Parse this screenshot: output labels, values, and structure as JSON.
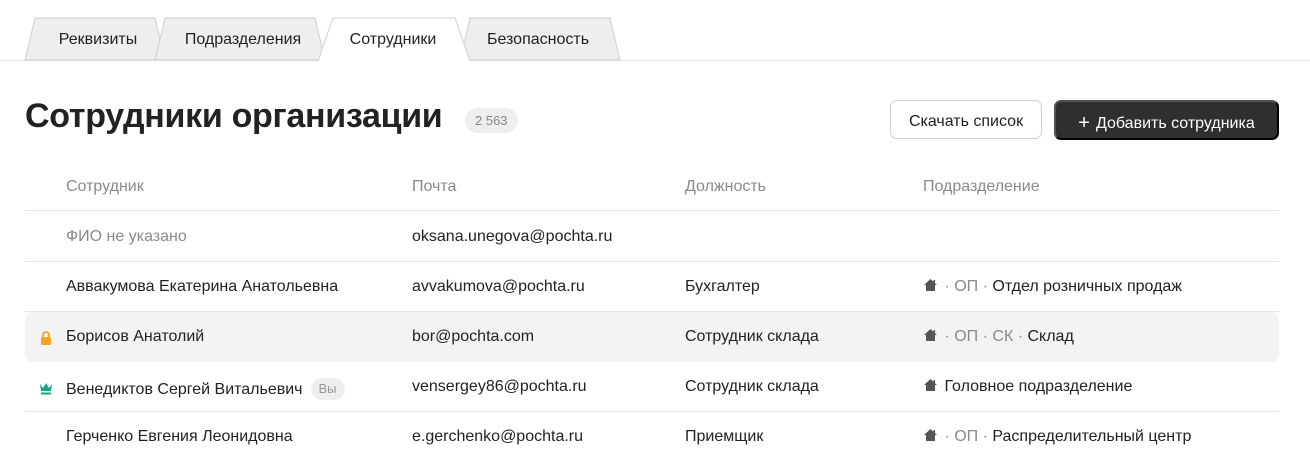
{
  "tabs": [
    {
      "label": "Реквизиты",
      "active": false
    },
    {
      "label": "Подразделения",
      "active": false
    },
    {
      "label": "Сотрудники",
      "active": true
    },
    {
      "label": "Безопасность",
      "active": false
    }
  ],
  "header": {
    "title": "Сотрудники организации",
    "count": "2 563",
    "download_label": "Скачать список",
    "add_label": "Добавить сотрудника",
    "add_icon": "+"
  },
  "table": {
    "columns": [
      "Сотрудник",
      "Почта",
      "Должность",
      "Подразделение"
    ],
    "rows": [
      {
        "name": "ФИО не указано",
        "email": "oksana.unegova@pochta.ru",
        "role": "",
        "dept_path": "",
        "dept": "",
        "icon": "none",
        "you": ""
      },
      {
        "name": "Аввакумова Екатерина Анатольевна",
        "email": "avvakumova@pochta.ru",
        "role": "Бухгалтер",
        "dept_path": " · ОП · ",
        "dept": "Отдел розничных продаж",
        "icon": "none",
        "you": ""
      },
      {
        "name": "Борисов Анатолий",
        "email": "bor@pochta.com",
        "role": "Сотрудник склада",
        "dept_path": " · ОП · СК · ",
        "dept": "Склад",
        "icon": "lock-icon",
        "you": ""
      },
      {
        "name": "Венедиктов Сергей Витальевич",
        "email": "vensergey86@pochta.ru",
        "role": "Сотрудник склада",
        "dept_path": " ",
        "dept": "Головное подразделение",
        "icon": "crown-icon",
        "you": "Вы"
      },
      {
        "name": "Герченко Евгения Леонидовна",
        "email": "e.gerchenko@pochta.ru",
        "role": "Приемщик",
        "dept_path": " · ОП · ",
        "dept": "Распределительный центр",
        "icon": "none",
        "you": ""
      }
    ]
  },
  "colors": {
    "lock": "#f5a623",
    "crown": "#1aa38a",
    "dark_button": "#2f2f2f"
  }
}
